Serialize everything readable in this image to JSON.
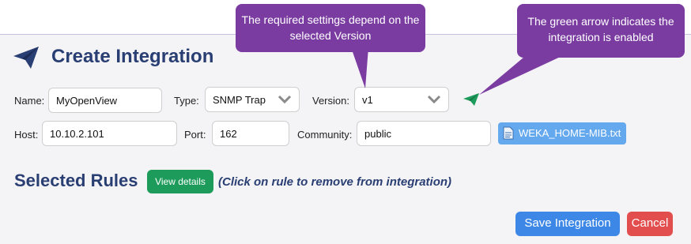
{
  "form": {
    "title": "Create Integration",
    "name_label": "Name:",
    "name_value": "MyOpenView",
    "type_label": "Type:",
    "type_value": "SNMP Trap",
    "version_label": "Version:",
    "version_value": "v1",
    "host_label": "Host:",
    "host_value": "10.10.2.101",
    "port_label": "Port:",
    "port_value": "162",
    "community_label": "Community:",
    "community_value": "public",
    "mib_file": "WEKA_HOME-MIB.txt"
  },
  "rules": {
    "title": "Selected Rules",
    "view_details": "View details",
    "hint": "(Click on rule to remove from integration)"
  },
  "actions": {
    "save": "Save Integration",
    "cancel": "Cancel"
  },
  "callouts": {
    "version": "The required settings depend on the selected Version",
    "enabled": "The green arrow indicates the integration is enabled"
  },
  "icons": {
    "title_icon": "paper-plane-icon",
    "enabled_icon": "paper-plane-icon",
    "file_icon": "document-icon",
    "select_arrow": "chevron-down-icon"
  },
  "colors": {
    "title": "#293e72",
    "callout": "#7b3ca2",
    "enabled": "#1d9b5b",
    "save": "#3d87e6",
    "cancel": "#e24d4d",
    "mib": "#64a8ee"
  }
}
